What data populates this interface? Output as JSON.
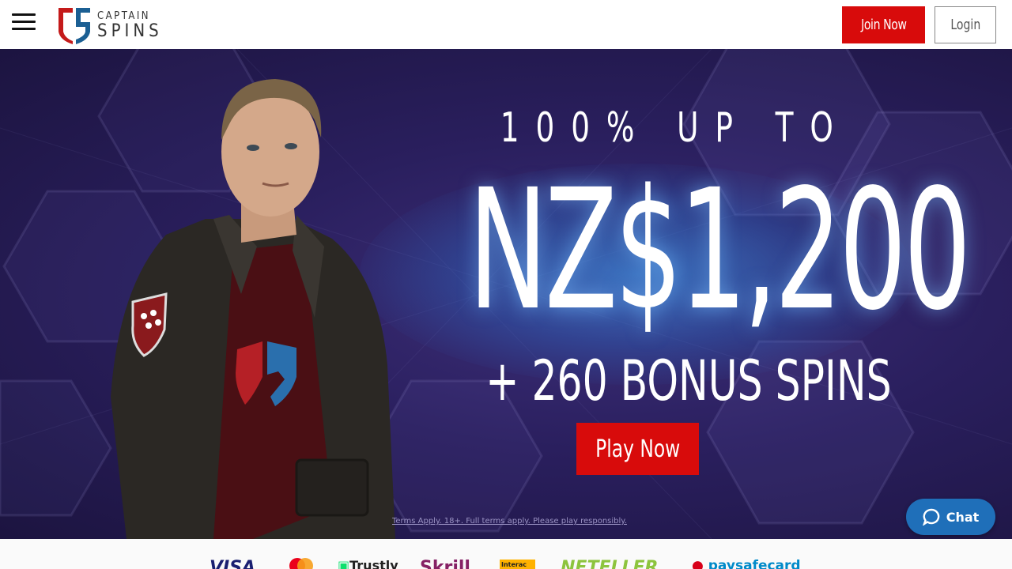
{
  "header": {
    "logo_line1": "CAPTAIN",
    "logo_line2": "SPINS",
    "join_label": "Join Now",
    "login_label": "Login"
  },
  "hero": {
    "line1": "100% UP TO",
    "amount": "NZ$1,200",
    "line3": "+ 260 BONUS SPINS",
    "cta_label": "Play Now",
    "terms": "Terms Apply. 18+. Full terms apply. Please play responsibly."
  },
  "chat": {
    "label": "Chat"
  },
  "payments": {
    "items": [
      "VISA",
      "mastercard",
      "Trustly",
      "Skrill",
      "Interac",
      "NETELLER",
      "paysafecard"
    ]
  },
  "colors": {
    "brand_red": "#d80b0b",
    "hero_bg": "#2a1f5e",
    "chat_blue": "#1f6fb9"
  }
}
